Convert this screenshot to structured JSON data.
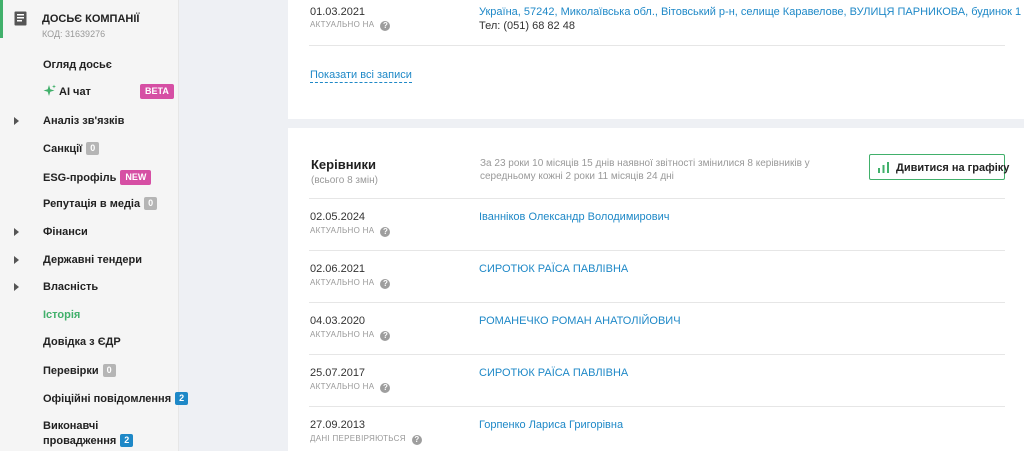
{
  "sidebar": {
    "dossier_title": "ДОСЬЄ КОМПАНІЇ",
    "dossier_code": "КОД: 31639276",
    "items": [
      {
        "label": "Огляд досьє"
      },
      {
        "label": "AI чат",
        "badge": "BETA"
      },
      {
        "label": "Аналіз зв'язків"
      },
      {
        "label": "Санкції",
        "badge": "0"
      },
      {
        "label": "ESG-профіль",
        "badge": "NEW"
      },
      {
        "label": "Репутація в медіа",
        "badge": "0"
      },
      {
        "label": "Фінанси"
      },
      {
        "label": "Державні тендери"
      },
      {
        "label": "Власність"
      },
      {
        "label": "Історія"
      },
      {
        "label": "Довідка з ЄДР"
      },
      {
        "label": "Перевірки",
        "badge": "0"
      },
      {
        "label": "Офіційні повідомлення",
        "badge": "2"
      },
      {
        "label_line1": "Виконавчі",
        "label_line2": "провадження",
        "badge": "2"
      }
    ]
  },
  "address_record": {
    "date": "01.03.2021",
    "status": "АКТУАЛЬНО НА",
    "address": "Україна, 57242, Миколаївська обл., Вітовський р-н, селище Каравелове, ВУЛИЦЯ ПАРНИКОВА, будинок 1",
    "phone": "Тел: (051) 68 82 48"
  },
  "show_all_label": "Показати всі записи",
  "directors": {
    "title": "Керівники",
    "subtitle": "(всього 8 змін)",
    "summary": "За 23 роки 10 місяців 15 днів наявної звітності змінилися 8 керівників у середньому кожні 2 роки 11 місяців 24 дні",
    "chart_button": "Дивитися на графіку",
    "rows": [
      {
        "date": "02.05.2024",
        "status": "АКТУАЛЬНО НА",
        "name": "Іванніков Олександр Володимирович"
      },
      {
        "date": "02.06.2021",
        "status": "АКТУАЛЬНО НА",
        "name": "СИРОТЮК РАЇСА ПАВЛІВНА"
      },
      {
        "date": "04.03.2020",
        "status": "АКТУАЛЬНО НА",
        "name": "РОМАНЕЧКО РОМАН АНАТОЛІЙОВИЧ"
      },
      {
        "date": "25.07.2017",
        "status": "АКТУАЛЬНО НА",
        "name": "СИРОТЮК РАЇСА ПАВЛІВНА"
      },
      {
        "date": "27.09.2013",
        "status": "ДАНІ ПЕРЕВІРЯЮТЬСЯ",
        "name": "Горпенко Лариса Григорівна"
      }
    ]
  },
  "help_glyph": "?",
  "colors": {
    "accent_green": "#41b06b",
    "link_blue": "#1e88c7",
    "badge_pink": "#d64fa4"
  }
}
